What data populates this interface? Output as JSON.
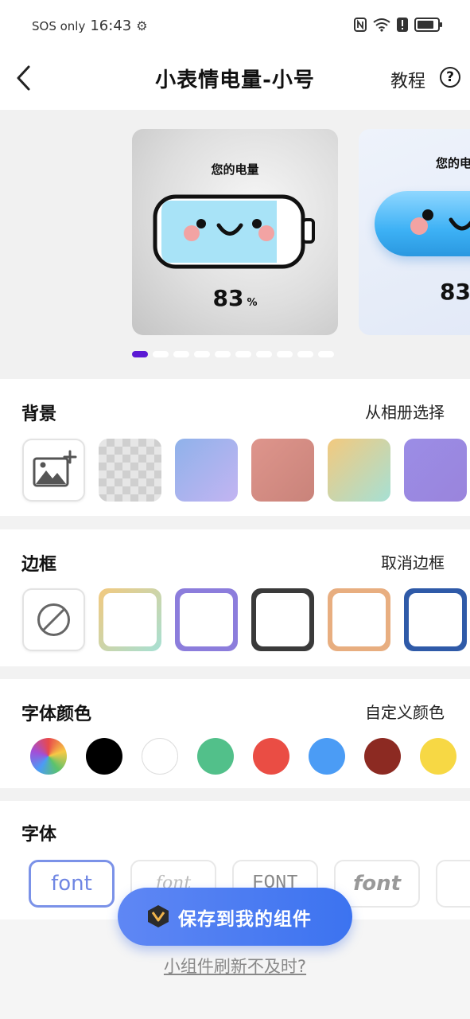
{
  "status_bar": {
    "carrier": "SOS only",
    "time": "16:43",
    "battery_level": 0.85
  },
  "header": {
    "title": "小表情电量-小号",
    "tutorial": "教程",
    "help": "?"
  },
  "preview": {
    "cards": [
      {
        "label": "您的电量",
        "percent": "83",
        "unit": "%"
      },
      {
        "label": "您的电量",
        "percent": "83"
      }
    ],
    "page_count": 10,
    "active_page": 0
  },
  "background": {
    "title": "背景",
    "action": "从相册选择",
    "swatches": [
      "add-image",
      "transparent",
      "blue-purple",
      "coral",
      "yellow-mint",
      "purple"
    ]
  },
  "border": {
    "title": "边框",
    "action": "取消边框",
    "options": [
      "none",
      "pastel-gradient",
      "purple",
      "black",
      "orange",
      "navy"
    ]
  },
  "font_color": {
    "title": "字体颜色",
    "action": "自定义颜色",
    "colors": [
      "#multicolor",
      "#000000",
      "#ffffff",
      "#52c08a",
      "#ea4d44",
      "#4b9cf5",
      "#8c2a22",
      "#f7d844"
    ]
  },
  "font": {
    "title": "字体",
    "options": [
      "font",
      "font",
      "FONT",
      "font"
    ]
  },
  "actions": {
    "save": "保存到我的组件",
    "refresh_help": "小组件刷新不及时?"
  },
  "colors": {
    "accent": "#3c73f0",
    "page_indicator": "#5b19d4"
  }
}
